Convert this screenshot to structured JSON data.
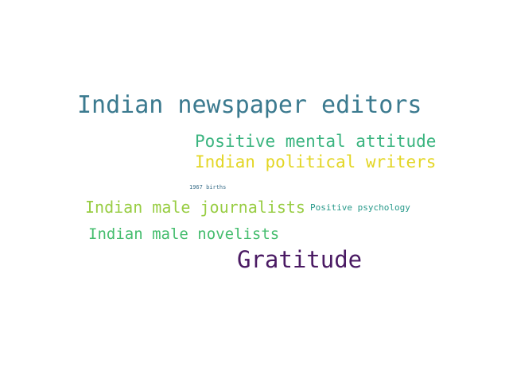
{
  "word_cloud": {
    "words": [
      {
        "text": "Indian newspaper editors",
        "color": "#3b7a8f"
      },
      {
        "text": "Positive mental attitude",
        "color": "#3ab47f"
      },
      {
        "text": "Indian political writers",
        "color": "#e3d624"
      },
      {
        "text": "1967 births",
        "color": "#3b6f8a"
      },
      {
        "text": "Indian male journalists",
        "color": "#98cd43"
      },
      {
        "text": "Positive psychology",
        "color": "#27998a"
      },
      {
        "text": "Indian male novelists",
        "color": "#45bd6e"
      },
      {
        "text": "Gratitude",
        "color": "#4a1a63"
      }
    ]
  }
}
